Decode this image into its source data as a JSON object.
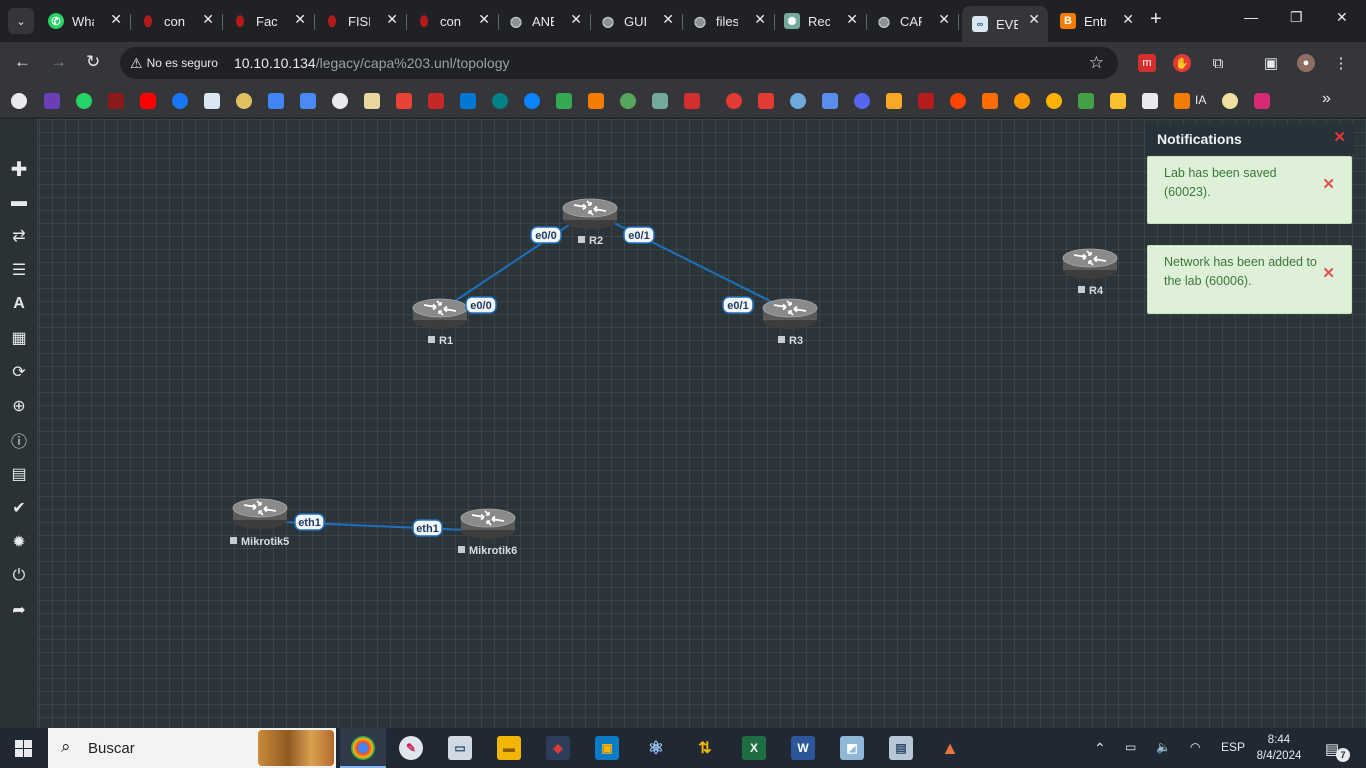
{
  "browser": {
    "tabs": [
      {
        "title": "WhatsApp",
        "icon": "whatsapp-icon",
        "color": "#25d366",
        "active": false
      },
      {
        "title": "con",
        "icon": "red-shield-icon",
        "color": "#b31b1b",
        "active": false
      },
      {
        "title": "Facu",
        "icon": "red-shield-icon",
        "color": "#b31b1b",
        "active": false
      },
      {
        "title": "FISE",
        "icon": "red-shield-icon",
        "color": "#b31b1b",
        "active": false
      },
      {
        "title": "con",
        "icon": "red-shield-icon",
        "color": "#b31b1b",
        "active": false
      },
      {
        "title": "ANE",
        "icon": "globe-icon",
        "color": "#9aa0a6",
        "active": false
      },
      {
        "title": "GUI",
        "icon": "globe-icon",
        "color": "#9aa0a6",
        "active": false
      },
      {
        "title": "files",
        "icon": "globe-icon",
        "color": "#9aa0a6",
        "active": false
      },
      {
        "title": "Rec",
        "icon": "chatgpt-icon",
        "color": "#74aa9c",
        "active": false
      },
      {
        "title": "CAP",
        "icon": "globe-icon",
        "color": "#9aa0a6",
        "active": false
      },
      {
        "title": "EVE",
        "icon": "eve-icon",
        "color": "#4a7db8",
        "active": true
      },
      {
        "title": "Entr",
        "icon": "blogger-icon",
        "color": "#f57c00",
        "active": false
      }
    ],
    "address": {
      "security_label": "No es seguro",
      "url_host": "10.10.10.134",
      "url_path": "/legacy/capa%203.unl/topology"
    }
  },
  "bookmarks": {
    "ia_label": "IA"
  },
  "sidebar_icons": [
    "add-icon",
    "nodes-icon",
    "networks-icon",
    "startup-configs-icon",
    "text-icon",
    "pictures-icon",
    "refresh-icon",
    "zoom-icon",
    "status-icon",
    "lab-details-icon",
    "lock-icon",
    "settings-icon",
    "power-icon",
    "logout-icon"
  ],
  "topology": {
    "nodes": [
      {
        "name": "R1"
      },
      {
        "name": "R2"
      },
      {
        "name": "R3"
      },
      {
        "name": "R4"
      },
      {
        "name": "Mikrotik5"
      },
      {
        "name": "Mikrotik6"
      }
    ],
    "links": [
      {
        "from": "R1",
        "from_if": "e0/0",
        "to": "R2",
        "to_if": "e0/0"
      },
      {
        "from": "R2",
        "from_if": "e0/1",
        "to": "R3",
        "to_if": "e0/1"
      },
      {
        "from": "Mikrotik5",
        "from_if": "eth1",
        "to": "Mikrotik6",
        "to_if": "eth1"
      }
    ],
    "link_color": "#1f6fbf"
  },
  "notifications": {
    "title": "Notifications",
    "items": [
      {
        "text": "Lab has been saved (60023)."
      },
      {
        "text": "Network has been added to the lab (60006)."
      }
    ]
  },
  "taskbar": {
    "search_placeholder": "Buscar",
    "language": "ESP",
    "time": "8:44",
    "date": "8/4/2024",
    "notification_count": "7"
  }
}
